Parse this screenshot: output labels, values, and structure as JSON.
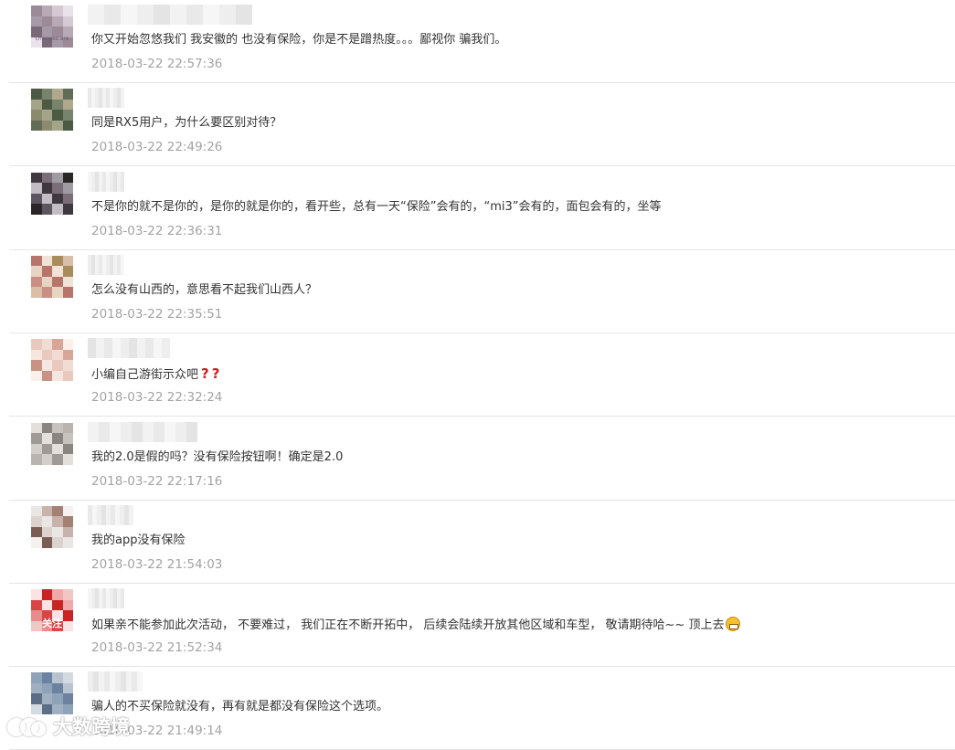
{
  "comments": [
    {
      "content": "你又开始忽悠我们 我安徽的 也没有保险，你是不是蹭热度。。。鄙视你 骗我们。",
      "time": "2018-03-22 22:57:36",
      "avatar_text": "changes are",
      "avatar_palette": [
        "#9c8a96",
        "#b8a9b6",
        "#d5c9d3",
        "#e9e2ea",
        "#7a6a78",
        "#a79aa8"
      ]
    },
    {
      "content": "同是RX5用户，为什么要区别对待？",
      "time": "2018-03-22 22:49:26",
      "avatar_palette": [
        "#616b55",
        "#8c8a6d",
        "#a3a48a",
        "#4c5a44",
        "#77836b",
        "#b0a78c"
      ]
    },
    {
      "content": "不是你的就不是你的，是你的就是你的，看开些，总有一天“保险”会有的，“mi3”会有的，面包会有的，坐等",
      "time": "2018-03-22 22:36:31",
      "avatar_palette": [
        "#3f3840",
        "#7b6e7a",
        "#a09aa3",
        "#2a2628",
        "#5e5560",
        "#c4bcc4"
      ]
    },
    {
      "content": "怎么没有山西的，意思看不起我们山西人？",
      "time": "2018-03-22 22:35:51",
      "avatar_palette": [
        "#d9bfa8",
        "#c98f84",
        "#e8d4c2",
        "#b6746b",
        "#efe3d6",
        "#a88c5c"
      ]
    },
    {
      "content": "小编自己游街示众吧",
      "time": "2018-03-22 22:32:24",
      "avatar_palette": [
        "#e9c9bd",
        "#f0dcd3",
        "#d9a597",
        "#fbefe9",
        "#c89384",
        "#f5e6df"
      ]
    },
    {
      "content": "我的2.0是假的吗？没有保险按钮啊！确定是2.0",
      "time": "2018-03-22 22:17:16",
      "avatar_palette": [
        "#b9b4ae",
        "#d2cec9",
        "#9f9a95",
        "#e3e0dc",
        "#8a8580",
        "#c6c2bd"
      ]
    },
    {
      "content": "我的app没有保险",
      "time": "2018-03-22 21:54:03",
      "avatar_palette": [
        "#e9e6e4",
        "#c7b3ac",
        "#a37f74",
        "#f4f1ef",
        "#7c5d52",
        "#dcd3cf"
      ]
    },
    {
      "content": "如果亲不能参加此次活动，  不要难过，  我们正在不断开拓中，  后续会陆续开放其他区域和车型，  敬请期待哈~~ 顶上去",
      "time": "2018-03-22 21:52:34",
      "avatar_text": "关注",
      "avatar_palette": [
        "#f3c6c6",
        "#e88d8d",
        "#d94545",
        "#fbe3e3",
        "#c82424",
        "#f1a8a8"
      ]
    },
    {
      "content": "骗人的不买保险就没有，再有就是都没有保险这个选项。",
      "time": "2018-03-22 21:49:14",
      "avatar_palette": [
        "#8ea2b8",
        "#6c82a0",
        "#b7c3cf",
        "#d3dae2",
        "#5b6e86",
        "#a1b0c0"
      ]
    }
  ],
  "watermark": {
    "text": "大数跨境"
  }
}
